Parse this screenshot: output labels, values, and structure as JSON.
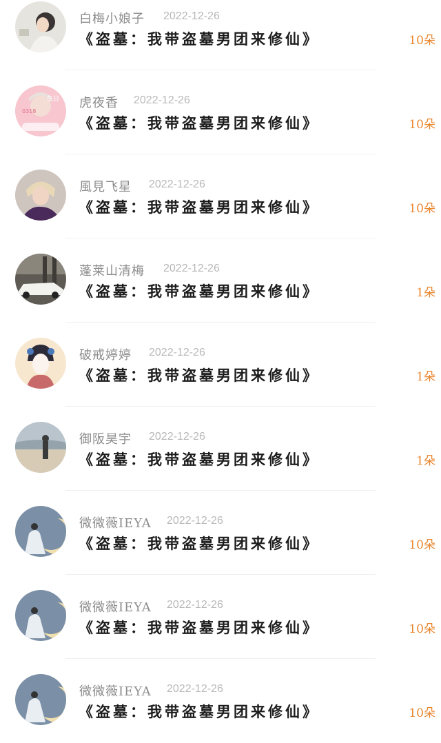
{
  "gifts": [
    {
      "name": "白梅小娘子",
      "date": "2022-12-26",
      "title": "《盗墓：我带盗墓男团来修仙》",
      "amount": "10朵",
      "avatar": "girl-portrait"
    },
    {
      "name": "虎夜香",
      "date": "2022-12-26",
      "title": "《盗墓：我带盗墓男团来修仙》",
      "amount": "10朵",
      "avatar": "birthday-portrait"
    },
    {
      "name": "風見飞星",
      "date": "2022-12-26",
      "title": "《盗墓：我带盗墓男团来修仙》",
      "amount": "10朵",
      "avatar": "boy-portrait"
    },
    {
      "name": "蓬莱山清梅",
      "date": "2022-12-26",
      "title": "《盗墓：我带盗墓男团来修仙》",
      "amount": "1朵",
      "avatar": "car-photo"
    },
    {
      "name": "破戒婷婷",
      "date": "2022-12-26",
      "title": "《盗墓：我带盗墓男团来修仙》",
      "amount": "1朵",
      "avatar": "geisha-illustration"
    },
    {
      "name": "御阪昊宇",
      "date": "2022-12-26",
      "title": "《盗墓：我带盗墓男团来修仙》",
      "amount": "1朵",
      "avatar": "beach-figure"
    },
    {
      "name": "微微薇IEYA",
      "date": "2022-12-26",
      "title": "《盗墓：我带盗墓男团来修仙》",
      "amount": "10朵",
      "avatar": "moon-scene"
    },
    {
      "name": "微微薇IEYA",
      "date": "2022-12-26",
      "title": "《盗墓：我带盗墓男团来修仙》",
      "amount": "10朵",
      "avatar": "moon-scene"
    },
    {
      "name": "微微薇IEYA",
      "date": "2022-12-26",
      "title": "《盗墓：我带盗墓男团来修仙》",
      "amount": "10朵",
      "avatar": "moon-scene"
    }
  ],
  "colors": {
    "amount": "#e9862e",
    "name": "#8c8c8c",
    "date": "#b8b8b8",
    "title": "#1c1c1c"
  }
}
